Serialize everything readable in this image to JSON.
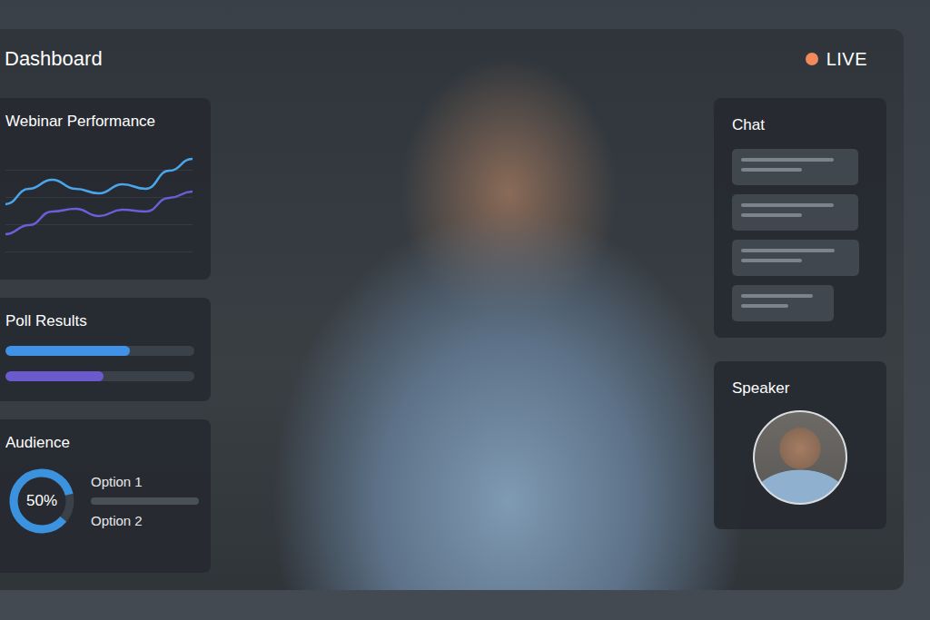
{
  "window": {
    "title": "Dashboard"
  },
  "live": {
    "label": "LIVE",
    "on": true
  },
  "performance": {
    "title": "Webinar Performance",
    "max": 110,
    "series": [
      {
        "name": "blue",
        "color": "#4aa6ec",
        "values": [
          48,
          65,
          75,
          65,
          60,
          70,
          65,
          85,
          98
        ]
      },
      {
        "name": "purple",
        "color": "#6a5fd6",
        "values": [
          15,
          25,
          40,
          43,
          35,
          42,
          40,
          55,
          62
        ]
      }
    ]
  },
  "poll": {
    "title": "Poll Results",
    "bars": [
      {
        "level": 0.66,
        "color": "#3f92e6"
      },
      {
        "level": 0.52,
        "color": "#6a5acd"
      }
    ]
  },
  "audience": {
    "title": "Audience",
    "reading": "50%",
    "level": 0.85,
    "options": [
      {
        "label": "Option 1",
        "kind": "bar"
      },
      {
        "label": "Option 2",
        "kind": "plain"
      }
    ]
  },
  "chat": {
    "title": "Chat",
    "messages": [
      {
        "lines": 2
      },
      {
        "lines": 2
      },
      {
        "lines": 2
      },
      {
        "lines": 2
      }
    ]
  },
  "speaker": {
    "title": "Speaker"
  }
}
